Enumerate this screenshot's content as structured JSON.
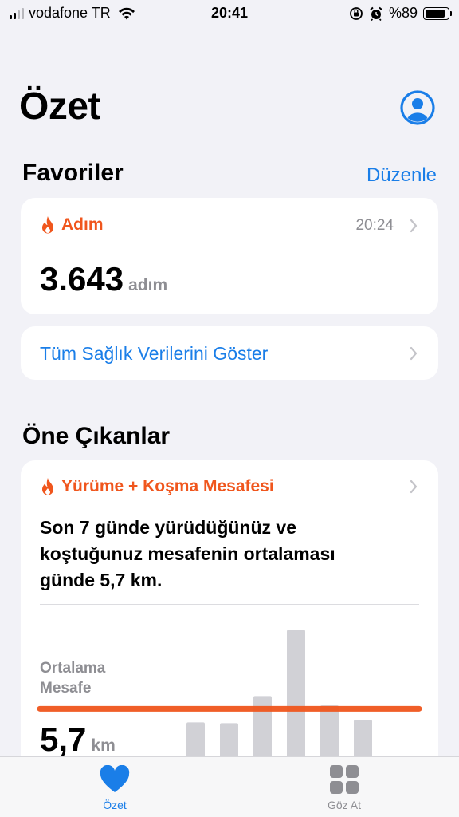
{
  "status_bar": {
    "carrier": "vodafone TR",
    "time": "20:41",
    "battery": "%89",
    "battery_level": 0.89
  },
  "header": {
    "title": "Özet"
  },
  "favorites": {
    "title": "Favoriler",
    "edit_label": "Düzenle",
    "steps_card": {
      "name": "Adım",
      "time": "20:24",
      "value": "3.643",
      "unit": "adım"
    },
    "show_all_label": "Tüm Sağlık Verilerini Göster"
  },
  "highlights": {
    "title": "Öne Çıkanlar",
    "card": {
      "name": "Yürüme + Koşma Mesafesi",
      "description": "Son 7 günde yürüdüğünüz ve koştuğunuz mesafenin ortalaması günde 5,7 km.",
      "avg_label_line1": "Ortalama",
      "avg_label_line2": "Mesafe",
      "avg_value": "5,7",
      "avg_unit": "km"
    }
  },
  "chart_data": {
    "type": "bar",
    "categories": [
      "",
      "",
      "",
      "",
      "",
      ""
    ],
    "values": [
      4.1,
      4.0,
      7.2,
      15.0,
      6.1,
      4.4
    ],
    "average": 5.7,
    "ylim": [
      0,
      15.5
    ],
    "colors": {
      "bars": "#d1d1d6",
      "average_line": "#f0561d"
    }
  },
  "tab_bar": {
    "summary_label": "Özet",
    "browse_label": "Göz At"
  },
  "colors": {
    "accent_blue": "#1a7ee8",
    "accent_orange": "#f0561d",
    "background": "#f2f2f7"
  }
}
